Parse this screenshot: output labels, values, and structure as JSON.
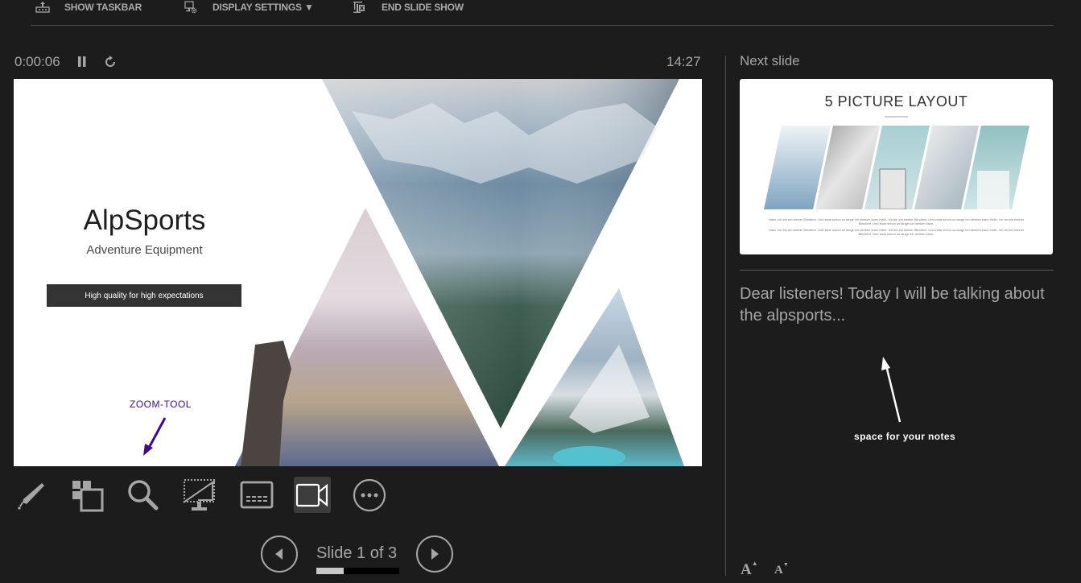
{
  "toolbar": {
    "show_taskbar": "SHOW TASKBAR",
    "display_settings": "DISPLAY SETTINGS ▼",
    "end_slide_show": "END SLIDE SHOW"
  },
  "timer": {
    "elapsed": "0:00:06",
    "clock": "14:27"
  },
  "current_slide": {
    "title": "AlpSports",
    "subtitle": "Adventure Equipment",
    "tagline": "High quality for high expectations",
    "image_description": "Mountain photo collage in triangles"
  },
  "annotations": {
    "zoom_tool": "ZOOM-TOOL",
    "notes_hint": "space for your notes"
  },
  "tools": [
    {
      "name": "pen-tool",
      "icon": "pen-icon"
    },
    {
      "name": "see-all-slides",
      "icon": "slides-grid-icon"
    },
    {
      "name": "zoom-into-slide",
      "icon": "magnifier-icon"
    },
    {
      "name": "black-screen",
      "icon": "screen-off-icon"
    },
    {
      "name": "toggle-subtitles",
      "icon": "subtitles-icon"
    },
    {
      "name": "camera-toggle",
      "icon": "camera-icon",
      "active": true
    },
    {
      "name": "more-options",
      "icon": "more-icon"
    }
  ],
  "navigation": {
    "slide_label": "Slide 1 of 3",
    "current": 1,
    "total": 3,
    "progress_fraction": 0.33
  },
  "next_slide": {
    "label": "Next slide",
    "title": "5 PICTURE LAYOUT",
    "body_1": "Hallo. Ich bin ein kleiner Blindtext. Und zwar schon so lange ich denken kann.Hallo. Ich bin ein kleiner Blindtext. Und zwar schon so lange ich denken kann.Hallo. Ich bin ein kleiner Blindtext. Und zwar schon so lange ich denken kann.",
    "body_2": "Hallo. Ich bin ein kleiner Blindtext. Und zwar schon so lange ich denken kann.Hallo. Ich bin ein kleiner Blindtext. Und zwar schon so lange ich denken kann.Hallo. Ich bin ein kleiner Blindtext. Und zwar schon so lange ich denken kann."
  },
  "notes": {
    "text": "Dear listeners! Today I will be talking about the alpsports..."
  },
  "font_controls": {
    "increase": "A",
    "decrease": "A"
  },
  "colors": {
    "background": "#1c1c1c",
    "text": "#a6a6a6",
    "annotation_purple": "#3d0b8c",
    "active_tool_bg": "#3c3c3c"
  }
}
